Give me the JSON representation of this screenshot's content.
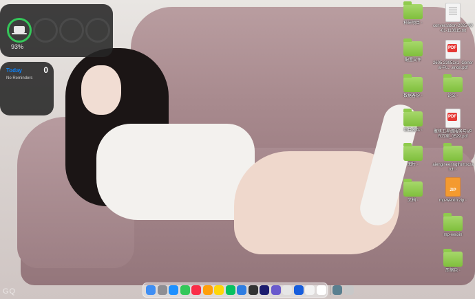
{
  "battery_widget": {
    "percent_label": "93%",
    "level": 0.93,
    "colors": {
      "ring_active": "#34c759",
      "ring_inactive": "#4a4a4a"
    }
  },
  "reminders_widget": {
    "title": "Today",
    "count": "0",
    "empty_label": "No Reminders",
    "title_color": "#0a84ff"
  },
  "desktop_icons": [
    {
      "type": "folder",
      "label": "科研项目 ◦"
    },
    {
      "type": "document",
      "label": "conversation-2025-09-01-113615.txt"
    },
    {
      "type": "folder",
      "label": "配置文件"
    },
    {
      "type": "pdf",
      "label": "2605.23051v1_General-Pu…ence.pdf"
    },
    {
      "type": "folder",
      "label": "数据备份 ◦"
    },
    {
      "type": "folder",
      "label": "论文 ◦"
    },
    {
      "type": "folder",
      "label": "项目资料 ◦"
    },
    {
      "type": "pdf",
      "label": "聚焦五星级服务与VPR方案_0529.pdf"
    },
    {
      "type": "folder",
      "label": "图片 ◦"
    },
    {
      "type": "folder",
      "label": "aiengineeringfromscratch ◦"
    },
    {
      "type": "folder",
      "label": "文档 ◦"
    },
    {
      "type": "zip",
      "label": "mp-weixin.zip ◦"
    },
    {
      "type": "folder",
      "label": "mp-weixin"
    },
    {
      "type": "folder",
      "label": "压缩包 ◦"
    }
  ],
  "dock": {
    "apps": [
      {
        "icon": "finder-icon",
        "color": "#3f8ef3"
      },
      {
        "icon": "launchpad-icon",
        "color": "#8e8e93"
      },
      {
        "icon": "safari-icon",
        "color": "#1e90ff"
      },
      {
        "icon": "messages-icon",
        "color": "#34c759"
      },
      {
        "icon": "music-icon",
        "color": "#fa2d48"
      },
      {
        "icon": "photos-icon",
        "color": "#ff9f0a"
      },
      {
        "icon": "notes-icon",
        "color": "#ffd60a"
      },
      {
        "icon": "wechat-icon",
        "color": "#07c160"
      },
      {
        "icon": "browser-icon",
        "color": "#2f7de1"
      },
      {
        "icon": "terminal-icon",
        "color": "#333333"
      },
      {
        "icon": "qq-icon",
        "color": "#1c1c6e"
      },
      {
        "icon": "pycharm-icon",
        "color": "#6a5acd"
      },
      {
        "icon": "vpn-icon",
        "color": "#e6e6e6"
      },
      {
        "icon": "bitwarden-icon",
        "color": "#175ddc"
      },
      {
        "icon": "mail-icon",
        "color": "#f2f2f2"
      },
      {
        "icon": "typora-icon",
        "color": "#ffffff"
      }
    ],
    "trailing": [
      {
        "icon": "downloads-folder-icon",
        "color": "#5a7f8f"
      },
      {
        "icon": "trash-icon",
        "color": "#c8c8c8"
      }
    ]
  },
  "watermark": "GQ"
}
